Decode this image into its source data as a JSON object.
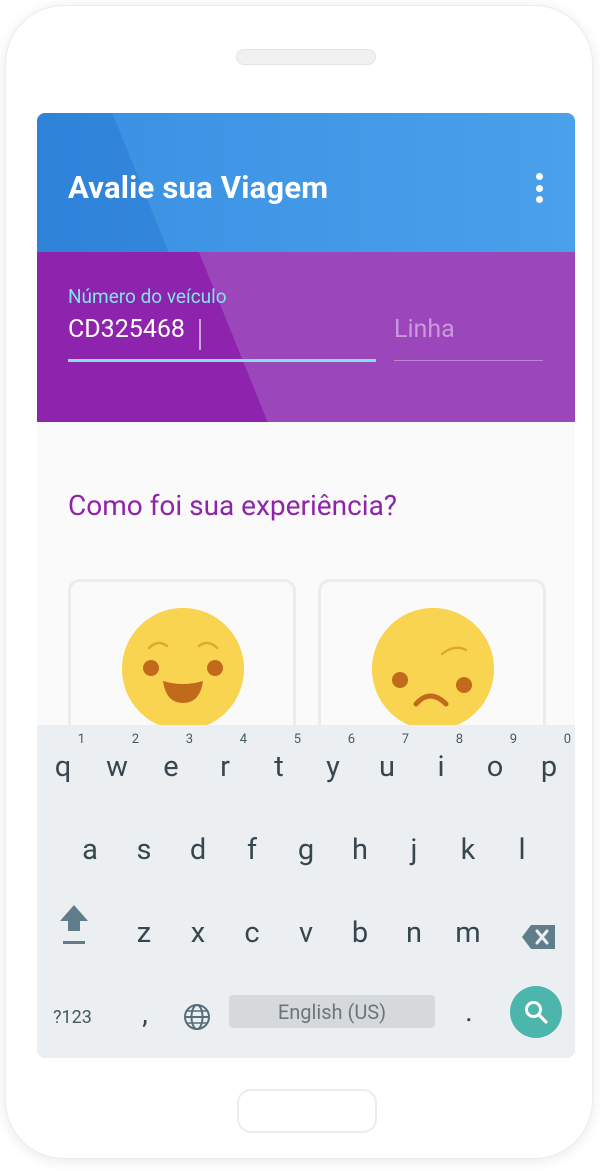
{
  "app": {
    "title": "Avalie sua Viagem"
  },
  "form": {
    "vehicle_label": "Número do veículo",
    "vehicle_value": "CD325468",
    "line_placeholder": "Linha"
  },
  "rating": {
    "question": "Como foi sua experiência?",
    "options": [
      {
        "icon": "happy-face-icon"
      },
      {
        "icon": "sad-face-icon"
      }
    ]
  },
  "keyboard": {
    "row1": [
      "q",
      "w",
      "e",
      "r",
      "t",
      "y",
      "u",
      "i",
      "o",
      "p"
    ],
    "row1_hints": [
      "1",
      "2",
      "3",
      "4",
      "5",
      "6",
      "7",
      "8",
      "9",
      "0"
    ],
    "row2": [
      "a",
      "s",
      "d",
      "f",
      "g",
      "h",
      "j",
      "k",
      "l"
    ],
    "row3": [
      "z",
      "x",
      "c",
      "v",
      "b",
      "n",
      "m"
    ],
    "symbols_label": "?123",
    "comma": ",",
    "period": ".",
    "space_label": "English (US)",
    "icons": {
      "shift": "shift-icon",
      "backspace": "backspace-icon",
      "language": "globe-icon",
      "action": "search-icon"
    }
  },
  "colors": {
    "appbar": "#4aa0ea",
    "input_panel": "#9c46bc",
    "accent_cyan": "#7fe3ea",
    "question_purple": "#8e24aa",
    "emoji_yellow": "#f8d450",
    "search_button": "#4db6ac"
  }
}
